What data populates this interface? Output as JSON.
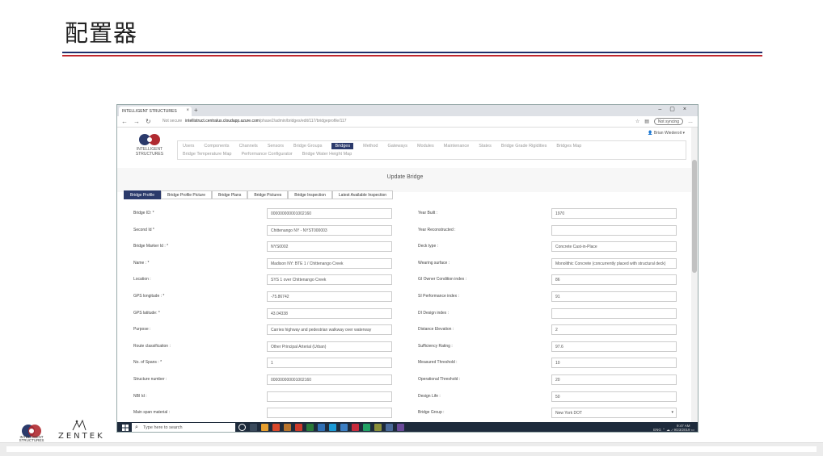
{
  "slide": {
    "title": "配置器",
    "footer_logo_text": "INTELLIGENT STRUCTURES",
    "footer_brand": "ZENTEK"
  },
  "browser": {
    "tab_title": "INTELLIGENT STRUCTURES",
    "address": {
      "security": "Not secure",
      "host": "intellistruct.centralus.cloudapp.azure.com",
      "path": "/phase2/admin/bridges/edit/117/bridgeprofile/117"
    },
    "sync_label": "Not syncing"
  },
  "app": {
    "user": "Brian Wiederoit",
    "logo_text": "INTELLIGENT STRUCTURES",
    "menu_row1": [
      "Users",
      "Components",
      "Channels",
      "Sensors",
      "Bridge Groups",
      "Bridges",
      "Method",
      "Gateways",
      "Modules",
      "Maintenance",
      "States",
      "Bridge Grade Rigidities",
      "Bridges Map"
    ],
    "menu_row2": [
      "Bridge Temperature Map",
      "Performance Configurator",
      "Bridge Water Height Map"
    ],
    "active_menu": "Bridges",
    "page_title": "Update Bridge",
    "tabs": [
      "Bridge Profile",
      "Bridge Profile Picture",
      "Bridge Plans",
      "Bridge Pictures",
      "Bridge Inspection",
      "Latest Available Inspection"
    ],
    "left_fields": [
      {
        "label": "Bridge ID: *",
        "value": "000000000001002160"
      },
      {
        "label": "Second Id *",
        "value": "Chittenango NY - NYST000003"
      },
      {
        "label": "Bridge Marker Id : *",
        "value": "NYS0002"
      },
      {
        "label": "Name : *",
        "value": "Madison NY: BTE 1 / Chittenango Creek"
      },
      {
        "label": "Location :",
        "value": "SYS 1 over Chittenango Creek"
      },
      {
        "label": "GPS longitude : *",
        "value": "-75.86742"
      },
      {
        "label": "GPS latitude: *",
        "value": "43.04338"
      },
      {
        "label": "Purpose :",
        "value": "Carries highway and pedestrian walkway over waterway"
      },
      {
        "label": "Route classification :",
        "value": "Other Principal Arterial (Urban)"
      },
      {
        "label": "No. of Spans : *",
        "value": "1"
      },
      {
        "label": "Structure number :",
        "value": "000000000001002160"
      },
      {
        "label": "NBI Id :",
        "value": ""
      },
      {
        "label": "Main span material :",
        "value": ""
      }
    ],
    "right_fields": [
      {
        "label": "Year Built :",
        "value": "1970"
      },
      {
        "label": "Year Reconstructed :",
        "value": ""
      },
      {
        "label": "Deck type :",
        "value": "Concrete Cast-in-Place"
      },
      {
        "label": "Wearing surface :",
        "value": "Monolithic Concrete (concurrently placed with structural deck)"
      },
      {
        "label": "GI Owner Condition index :",
        "value": "86"
      },
      {
        "label": "SI Performance index :",
        "value": "91"
      },
      {
        "label": "DI Design index :",
        "value": ""
      },
      {
        "label": "Distance Elevation :",
        "value": "2"
      },
      {
        "label": "Sufficiency Rating :",
        "value": "97.6"
      },
      {
        "label": "Measured Threshold :",
        "value": "10"
      },
      {
        "label": "Operational Threshold :",
        "value": "20"
      },
      {
        "label": "Design Life :",
        "value": "50"
      },
      {
        "label": "Bridge Group :",
        "value": "New York DOT"
      }
    ]
  },
  "taskbar": {
    "search_placeholder": "Type here to search",
    "tray_lang": "ENG",
    "tray_time": "9:47 AM",
    "tray_date": "9/23/2019"
  },
  "colors": {
    "accent_navy": "#2b3a6b",
    "rule_blue": "#1f2e6b",
    "rule_red": "#c0262d",
    "taskbar": "#1e2b3c"
  }
}
